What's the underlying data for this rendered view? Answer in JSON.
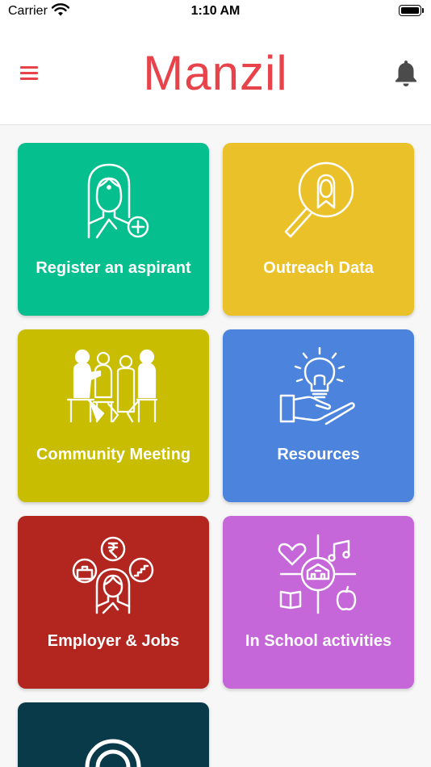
{
  "status_bar": {
    "carrier": "Carrier",
    "time": "1:10 AM"
  },
  "header": {
    "title": "Manzil",
    "menu_icon": "hamburger-menu-icon",
    "bell_icon": "bell-icon"
  },
  "colors": {
    "brand": "#e8434a",
    "register": "#06bf8e",
    "outreach": "#ebc129",
    "community": "#c9bd02",
    "resources": "#4c83dd",
    "employer": "#b32620",
    "school": "#c566d9",
    "more": "#083a49"
  },
  "tiles": [
    {
      "label": "Register an aspirant",
      "icon": "woman-plus-icon"
    },
    {
      "label": "Outreach Data",
      "icon": "magnifier-person-icon"
    },
    {
      "label": "Community Meeting",
      "icon": "people-meeting-icon"
    },
    {
      "label": "Resources",
      "icon": "hand-lightbulb-icon"
    },
    {
      "label": "Employer & Jobs",
      "icon": "woman-jobs-icon"
    },
    {
      "label": "In School activities",
      "icon": "school-activities-icon"
    },
    {
      "label": "",
      "icon": "ring-icon"
    }
  ]
}
